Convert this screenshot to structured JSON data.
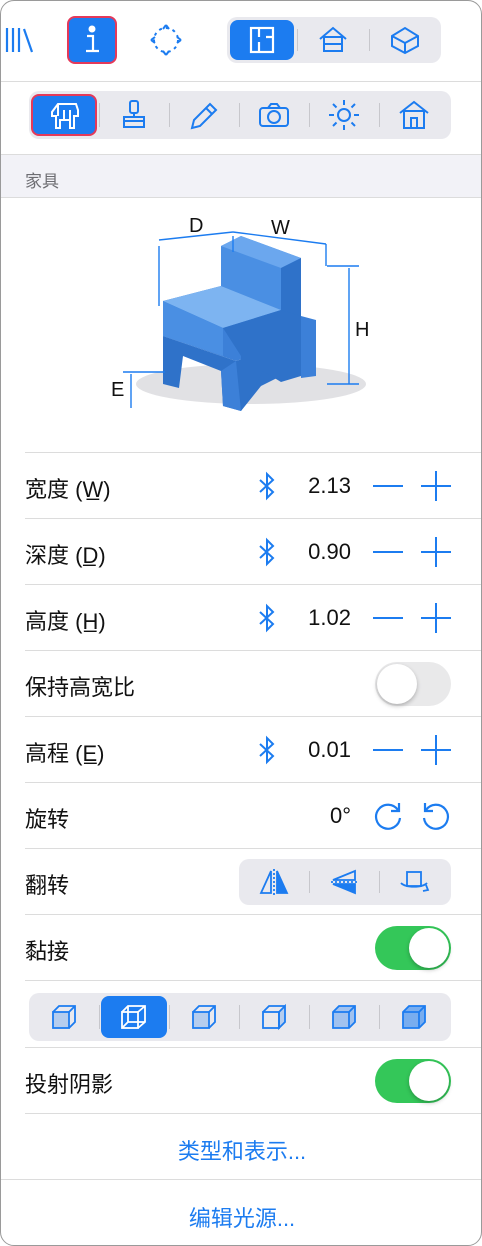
{
  "section_header": "家具",
  "dimension_labels": {
    "depth": "D",
    "width": "W",
    "height": "H",
    "elevation": "E"
  },
  "rows": {
    "width": {
      "label": "宽度 (W̲)",
      "value": "2.13"
    },
    "depth": {
      "label": "深度 (D̲)",
      "value": "0.90"
    },
    "height": {
      "label": "高度 (H̲)",
      "value": "1.02"
    },
    "keep_ratio": {
      "label": "保持高宽比",
      "on": false
    },
    "elevation": {
      "label": "高程 (E̲)",
      "value": "0.01"
    },
    "rotation": {
      "label": "旋转",
      "value": "0°"
    },
    "flip": {
      "label": "翻转"
    },
    "snap": {
      "label": "黏接",
      "on": true
    },
    "cast_shadow": {
      "label": "投射阴影",
      "on": true
    }
  },
  "links": {
    "type_and_display": "类型和表示...",
    "edit_lights": "编辑光源..."
  },
  "colors": {
    "accent": "#1c7cf0",
    "highlight_border": "#e4395a",
    "toggle_on": "#34c759",
    "chair": "#4a8fe3"
  },
  "icons": {
    "toolbar": [
      "library-icon",
      "info-icon",
      "center-view-icon",
      "floorplan-icon",
      "house-front-icon",
      "house-3d-icon"
    ],
    "categories": [
      "furniture-icon",
      "paint-brush-icon",
      "pencil-icon",
      "camera-icon",
      "sun-icon",
      "house-icon"
    ],
    "views": [
      "cube-front-icon",
      "cube-selected-icon",
      "cube-left-icon",
      "cube-right-icon",
      "cube-dotted-icon",
      "cube-shaded-icon"
    ]
  }
}
